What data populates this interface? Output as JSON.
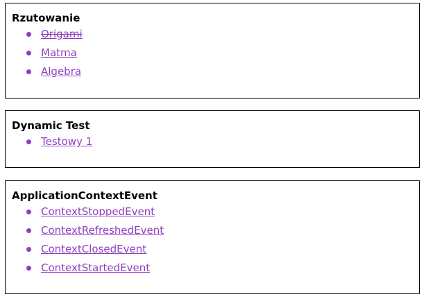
{
  "colors": {
    "link": "#8e3fbf",
    "border": "#000000",
    "title": "#000000"
  },
  "sections": [
    {
      "title": "Rzutowanie",
      "items": [
        {
          "label": "Origami",
          "struck": true
        },
        {
          "label": "Matma",
          "struck": false
        },
        {
          "label": "Algebra",
          "struck": false
        }
      ]
    },
    {
      "title": "Dynamic Test",
      "items": [
        {
          "label": "Testowy 1",
          "struck": false
        }
      ]
    },
    {
      "title": "ApplicationContextEvent",
      "items": [
        {
          "label": "ContextStoppedEvent",
          "struck": false
        },
        {
          "label": "ContextRefreshedEvent",
          "struck": false
        },
        {
          "label": "ContextClosedEvent",
          "struck": false
        },
        {
          "label": "ContextStartedEvent",
          "struck": false
        }
      ]
    }
  ]
}
